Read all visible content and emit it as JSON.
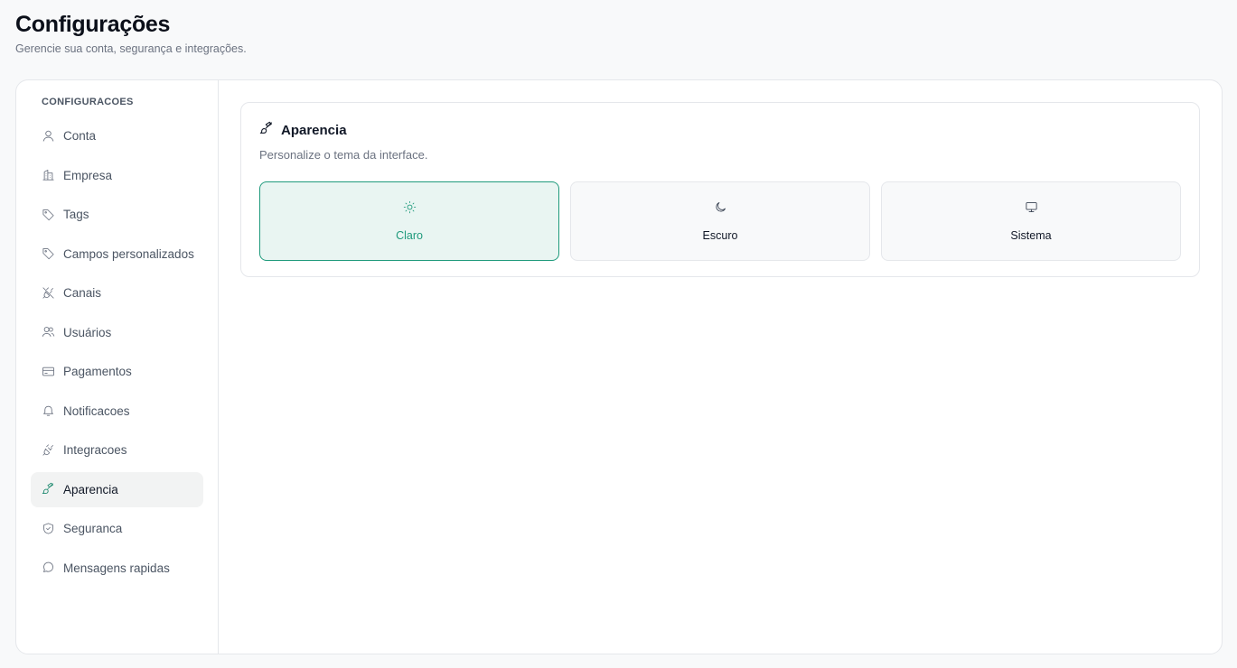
{
  "header": {
    "title": "Configurações",
    "subtitle": "Gerencie sua conta, segurança e integrações."
  },
  "sidebar": {
    "heading": "CONFIGURACOES",
    "items": [
      {
        "label": "Conta",
        "icon": "user-icon"
      },
      {
        "label": "Empresa",
        "icon": "building-icon"
      },
      {
        "label": "Tags",
        "icon": "tag-icon"
      },
      {
        "label": "Campos personalizados",
        "icon": "tag-icon"
      },
      {
        "label": "Canais",
        "icon": "plug-off-icon"
      },
      {
        "label": "Usuários",
        "icon": "users-icon"
      },
      {
        "label": "Pagamentos",
        "icon": "credit-card-icon"
      },
      {
        "label": "Notificacoes",
        "icon": "bell-icon"
      },
      {
        "label": "Integracoes",
        "icon": "plug-icon"
      },
      {
        "label": "Aparencia",
        "icon": "paintbrush-icon",
        "active": true
      },
      {
        "label": "Seguranca",
        "icon": "shield-icon"
      },
      {
        "label": "Mensagens rapidas",
        "icon": "message-circle-icon"
      }
    ]
  },
  "appearance": {
    "title": "Aparencia",
    "description": "Personalize o tema da interface.",
    "options": [
      {
        "label": "Claro",
        "icon": "sun-icon",
        "selected": true
      },
      {
        "label": "Escuro",
        "icon": "moon-icon",
        "selected": false
      },
      {
        "label": "Sistema",
        "icon": "monitor-icon",
        "selected": false
      }
    ]
  },
  "colors": {
    "accent": "#1f9a7c",
    "accent_bg": "#e9f5f2"
  }
}
